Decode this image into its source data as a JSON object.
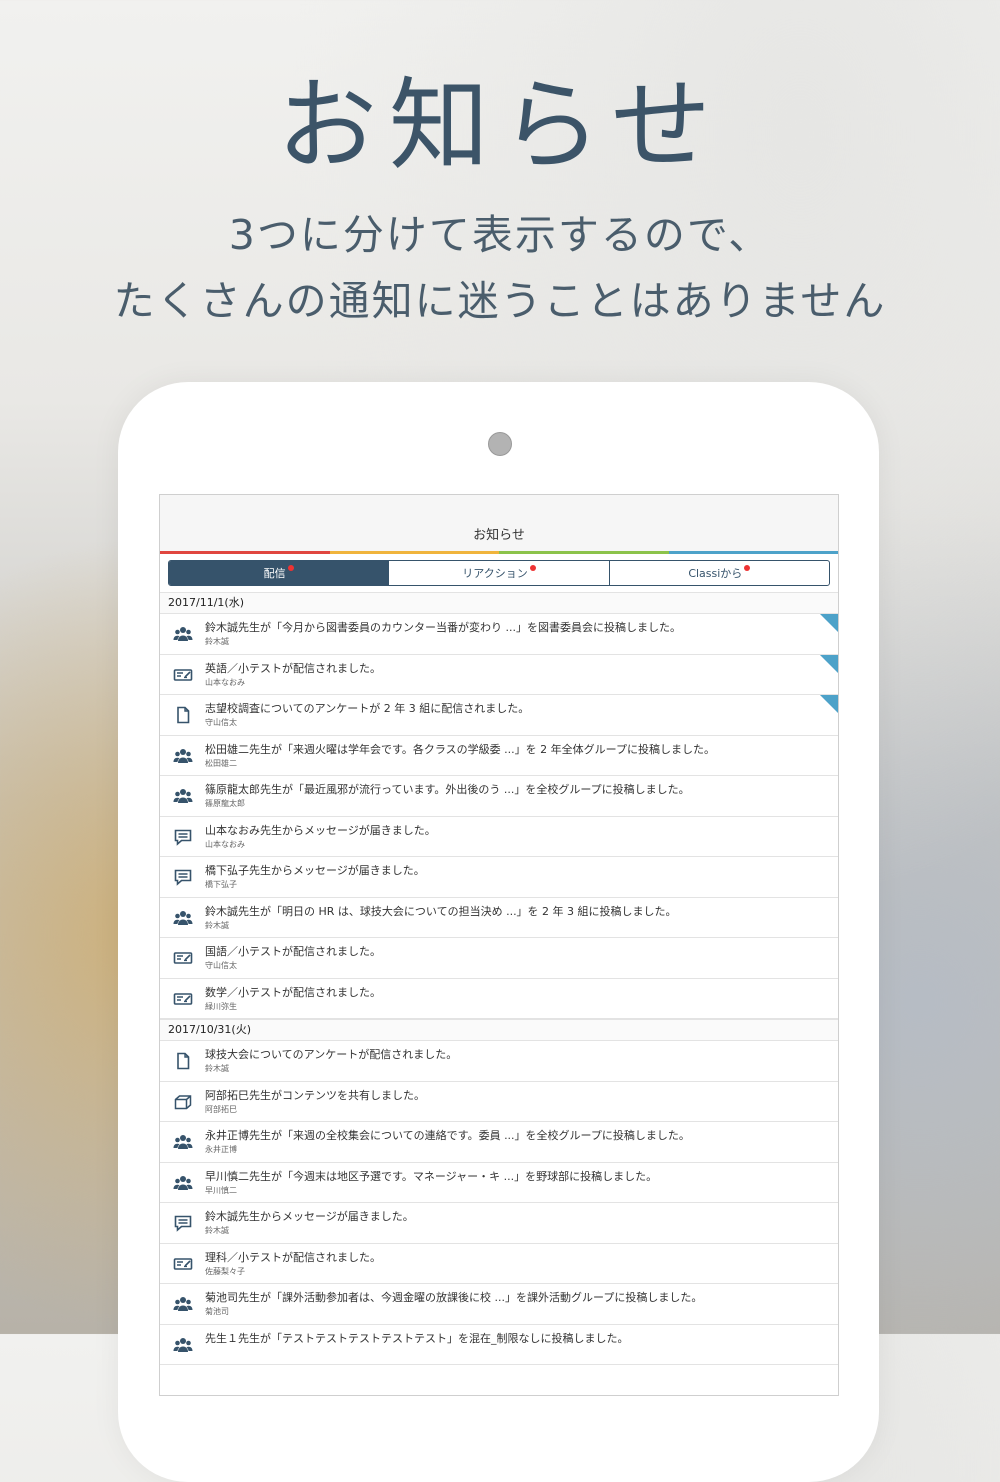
{
  "promo": {
    "headline": "お知らせ",
    "sub1": "3つに分けて表示するので、",
    "sub2": "たくさんの通知に迷うことはありません"
  },
  "app": {
    "title": "お知らせ",
    "rainbow_colors": [
      "#e0463f",
      "#f0b43c",
      "#8cc34a",
      "#4da2c9"
    ],
    "accent": "#36536b",
    "tabs": [
      {
        "label": "配信",
        "active": true,
        "badge": true
      },
      {
        "label": "リアクション",
        "active": false,
        "badge": true
      },
      {
        "label": "Classiから",
        "active": false,
        "badge": true
      }
    ],
    "groups": [
      {
        "date": "2017/11/1(水)",
        "items": [
          {
            "icon": "group-icon",
            "title": "鈴木誠先生が「今月から図書委員のカウンター当番が変わり ...」を図書委員会に投稿しました。",
            "author": "鈴木誠",
            "unread": true
          },
          {
            "icon": "quiz-icon",
            "title": "英語／小テストが配信されました。",
            "author": "山本なおみ",
            "unread": true
          },
          {
            "icon": "document-icon",
            "title": "志望校調査についてのアンケートが 2 年 3 組に配信されました。",
            "author": "守山信太",
            "unread": true
          },
          {
            "icon": "group-icon",
            "title": "松田雄二先生が「来週火曜は学年会です。各クラスの学級委 ...」を 2 年全体グループに投稿しました。",
            "author": "松田雄二",
            "unread": false
          },
          {
            "icon": "group-icon",
            "title": "篠原龍太郎先生が「最近風邪が流行っています。外出後のう ...」を全校グループに投稿しました。",
            "author": "篠原龍太郎",
            "unread": false
          },
          {
            "icon": "message-icon",
            "title": "山本なおみ先生からメッセージが届きました。",
            "author": "山本なおみ",
            "unread": false
          },
          {
            "icon": "message-icon",
            "title": "橋下弘子先生からメッセージが届きました。",
            "author": "橋下弘子",
            "unread": false
          },
          {
            "icon": "group-icon",
            "title": "鈴木誠先生が「明日の HR は、球技大会についての担当決め ...」を 2 年 3 組に投稿しました。",
            "author": "鈴木誠",
            "unread": false
          },
          {
            "icon": "quiz-icon",
            "title": "国語／小テストが配信されました。",
            "author": "守山信太",
            "unread": false
          },
          {
            "icon": "quiz-icon",
            "title": "数学／小テストが配信されました。",
            "author": "緑川弥生",
            "unread": false
          }
        ]
      },
      {
        "date": "2017/10/31(火)",
        "items": [
          {
            "icon": "document-icon",
            "title": "球技大会についてのアンケートが配信されました。",
            "author": "鈴木誠",
            "unread": false
          },
          {
            "icon": "box-icon",
            "title": "阿部拓巳先生がコンテンツを共有しました。",
            "author": "阿部拓巳",
            "unread": false
          },
          {
            "icon": "group-icon",
            "title": "永井正博先生が「来週の全校集会についての連絡です。委員 ...」を全校グループに投稿しました。",
            "author": "永井正博",
            "unread": false
          },
          {
            "icon": "group-icon",
            "title": "早川慎二先生が「今週末は地区予選です。マネージャー・キ ...」を野球部に投稿しました。",
            "author": "早川慎二",
            "unread": false
          },
          {
            "icon": "message-icon",
            "title": "鈴木誠先生からメッセージが届きました。",
            "author": "鈴木誠",
            "unread": false
          },
          {
            "icon": "quiz-icon",
            "title": "理科／小テストが配信されました。",
            "author": "佐藤梨々子",
            "unread": false
          },
          {
            "icon": "group-icon",
            "title": "菊池司先生が「課外活動参加者は、今週金曜の放課後に校 ...」を課外活動グループに投稿しました。",
            "author": "菊池司",
            "unread": false
          },
          {
            "icon": "group-icon",
            "title": "先生１先生が「テストテストテストテストテスト」を混在_制限なしに投稿しました。",
            "author": "",
            "unread": false
          }
        ]
      }
    ]
  }
}
